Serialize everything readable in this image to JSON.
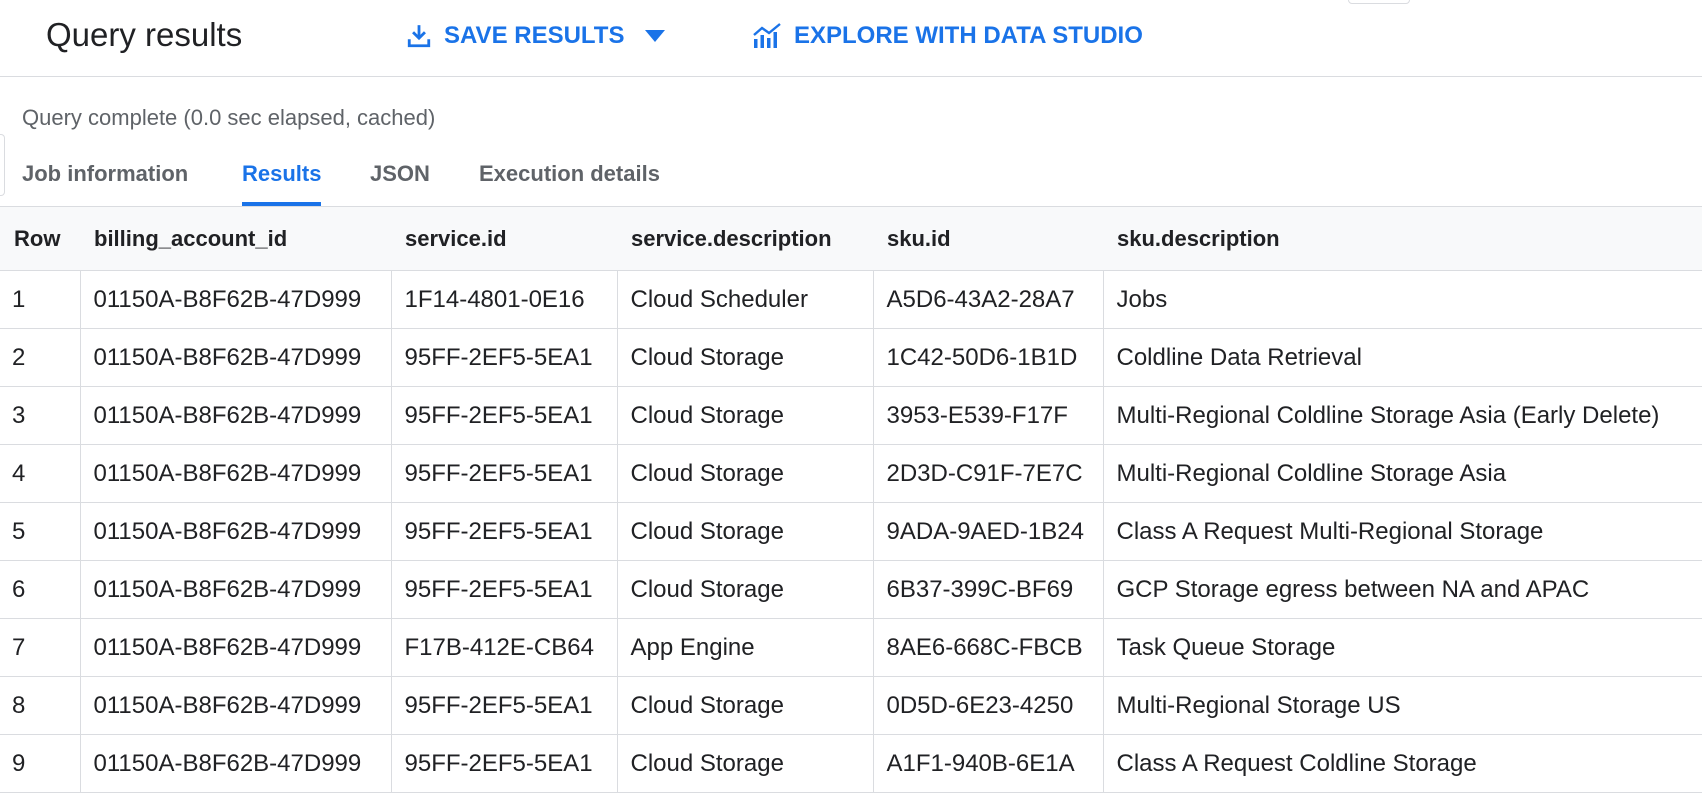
{
  "header": {
    "title": "Query results",
    "save_label": "SAVE RESULTS",
    "explore_label": "EXPLORE WITH DATA STUDIO",
    "accent_color": "#1a73e8"
  },
  "status": "Query complete (0.0 sec elapsed, cached)",
  "tabs": [
    {
      "label": "Job information",
      "active": false
    },
    {
      "label": "Results",
      "active": true
    },
    {
      "label": "JSON",
      "active": false
    },
    {
      "label": "Execution details",
      "active": false
    }
  ],
  "table": {
    "columns": [
      "Row",
      "billing_account_id",
      "service.id",
      "service.description",
      "sku.id",
      "sku.description"
    ],
    "rows": [
      [
        "1",
        "01150A-B8F62B-47D999",
        "1F14-4801-0E16",
        "Cloud Scheduler",
        "A5D6-43A2-28A7",
        "Jobs"
      ],
      [
        "2",
        "01150A-B8F62B-47D999",
        "95FF-2EF5-5EA1",
        "Cloud Storage",
        "1C42-50D6-1B1D",
        "Coldline Data Retrieval"
      ],
      [
        "3",
        "01150A-B8F62B-47D999",
        "95FF-2EF5-5EA1",
        "Cloud Storage",
        "3953-E539-F17F",
        "Multi-Regional Coldline Storage Asia (Early Delete)"
      ],
      [
        "4",
        "01150A-B8F62B-47D999",
        "95FF-2EF5-5EA1",
        "Cloud Storage",
        "2D3D-C91F-7E7C",
        "Multi-Regional Coldline Storage Asia"
      ],
      [
        "5",
        "01150A-B8F62B-47D999",
        "95FF-2EF5-5EA1",
        "Cloud Storage",
        "9ADA-9AED-1B24",
        "Class A Request Multi-Regional Storage"
      ],
      [
        "6",
        "01150A-B8F62B-47D999",
        "95FF-2EF5-5EA1",
        "Cloud Storage",
        "6B37-399C-BF69",
        "GCP Storage egress between NA and APAC"
      ],
      [
        "7",
        "01150A-B8F62B-47D999",
        "F17B-412E-CB64",
        "App Engine",
        "8AE6-668C-FBCB",
        "Task Queue Storage"
      ],
      [
        "8",
        "01150A-B8F62B-47D999",
        "95FF-2EF5-5EA1",
        "Cloud Storage",
        "0D5D-6E23-4250",
        "Multi-Regional Storage US"
      ],
      [
        "9",
        "01150A-B8F62B-47D999",
        "95FF-2EF5-5EA1",
        "Cloud Storage",
        "A1F1-940B-6E1A",
        "Class A Request Coldline Storage"
      ]
    ]
  },
  "icons": {
    "save": "download-icon",
    "dropdown": "caret-down-icon",
    "explore": "chart-icon"
  }
}
